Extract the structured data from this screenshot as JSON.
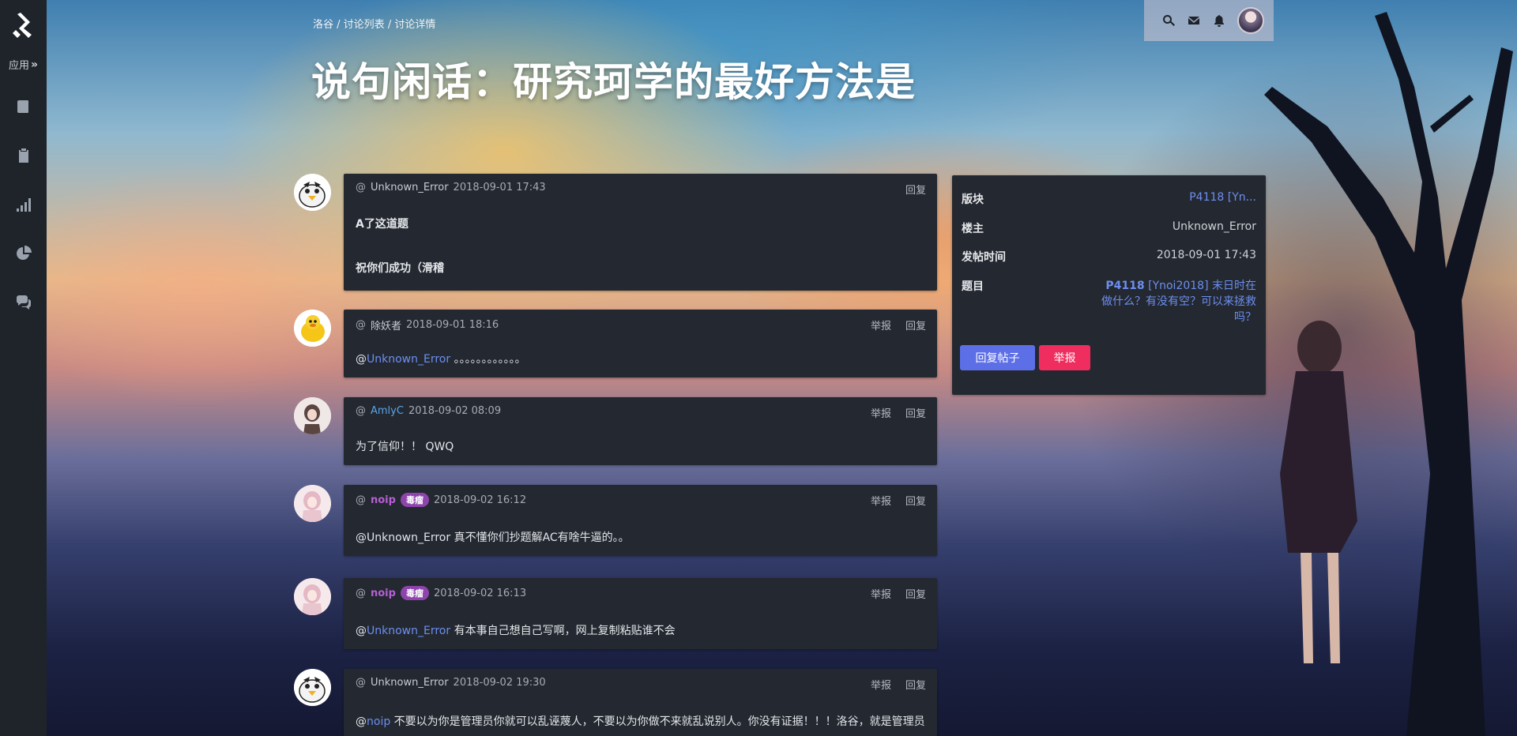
{
  "breadcrumb": {
    "home": "洛谷",
    "sep1": " / ",
    "list": "讨论列表",
    "sep2": " / ",
    "detail": "讨论详情"
  },
  "title": "说句闲话：研究珂学的最好方法是",
  "sidebar": {
    "apps_label": "应用",
    "apps_chevron": "»"
  },
  "posts": [
    {
      "user": "Unknown_Error",
      "time": "2018-09-01 17:43",
      "reply": "回复",
      "line1": "A了这道题",
      "line2": "祝你们成功（滑稽"
    },
    {
      "user": "除妖者",
      "time": "2018-09-01 18:16",
      "report": "举报",
      "reply": "回复",
      "at": "@",
      "mention": "Unknown_Error",
      "text": " 。。。。。。。。。。。。"
    },
    {
      "user": "AmlyC",
      "time": "2018-09-02 08:09",
      "report": "举报",
      "reply": "回复",
      "text": "为了信仰！！ QWQ"
    },
    {
      "user": "noip",
      "badge": "毒瘤",
      "time": "2018-09-02 16:12",
      "report": "举报",
      "reply": "回复",
      "text": "@Unknown_Error 真不懂你们抄题解AC有啥牛逼的。。"
    },
    {
      "user": "noip",
      "badge": "毒瘤",
      "time": "2018-09-02 16:13",
      "report": "举报",
      "reply": "回复",
      "at": "@",
      "mention": "Unknown_Error",
      "text": " 有本事自己想自己写啊，网上复制粘贴谁不会"
    },
    {
      "user": "Unknown_Error",
      "time": "2018-09-02 19:30",
      "report": "举报",
      "reply": "回复",
      "at": "@",
      "mention": "noip",
      "text": " 不要以为你是管理员你就可以乱诬蔑人，不要以为你做不来就乱说别人。你没有证据！！！洛谷，就是管理员"
    }
  ],
  "info": {
    "section_label": "版块",
    "section_value": "P4118 [Yn...",
    "owner_label": "楼主",
    "owner_value": "Unknown_Error",
    "time_label": "发帖时间",
    "time_value": "2018-09-01 17:43",
    "problem_label": "题目",
    "problem_id": "P4118",
    "problem_title": " [Ynoi2018] 末日时在做什么？有没有空？可以来拯救吗？",
    "reply_button": "回复帖子",
    "report_button": "举报"
  },
  "colors": {
    "accent": "#5d6fe6",
    "danger": "#ef2d5e",
    "link": "#6c8ff0",
    "badge": "#8e44ad",
    "sidebar": "#1f242b",
    "card": "#242830"
  }
}
